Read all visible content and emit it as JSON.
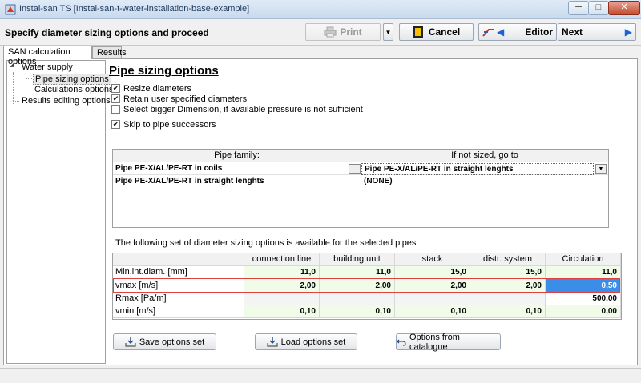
{
  "window": {
    "title": "Instal-san TS [Instal-san-t-water-installation-base-example]",
    "minimize": "─",
    "maximize": "□",
    "close": "✕"
  },
  "header": {
    "title": "Specify diameter sizing options and proceed",
    "print_label": "Print",
    "print_dropdown": "▼",
    "cancel_label": "Cancel",
    "editor_label": "Editor",
    "next_label": "Next",
    "left_arrow": "◀",
    "right_arrow": "▶"
  },
  "tabs": [
    {
      "label": "SAN calculation options"
    },
    {
      "label": "Results"
    }
  ],
  "tree": {
    "root": "Water supply",
    "expander": "◢",
    "children": [
      "Pipe sizing options",
      "Calculations options"
    ],
    "other": "Results editing options"
  },
  "section": {
    "title": "Pipe sizing options"
  },
  "checkboxes": [
    {
      "label": "Resize diameters",
      "checked": true
    },
    {
      "label": "Retain user specified diameters",
      "checked": true
    },
    {
      "label": "Select bigger Dimension, if available pressure is not sufficient",
      "checked": false
    },
    {
      "label": "Skip to pipe successors",
      "checked": true
    }
  ],
  "family_grid": {
    "headers": [
      "Pipe family:",
      "If not sized, go to"
    ],
    "rows": [
      [
        "Pipe PE-X/AL/PE-RT in coils",
        "Pipe PE-X/AL/PE-RT in straight lenghts"
      ],
      [
        "Pipe PE-X/AL/PE-RT in straight lenghts",
        "(NONE)"
      ]
    ],
    "dots": "...",
    "drop": "▼"
  },
  "info_text": "The following set of diameter sizing options is available for the selected pipes",
  "options_grid": {
    "headers": [
      "",
      "connection line",
      "building unit",
      "stack",
      "distr. system",
      "Circulation"
    ],
    "rows": [
      {
        "label": "Min.int.diam. [mm]",
        "values": [
          "11,0",
          "11,0",
          "15,0",
          "15,0",
          "11,0"
        ]
      },
      {
        "label": "vmax [m/s]",
        "values": [
          "2,00",
          "2,00",
          "2,00",
          "2,00",
          "0,50"
        ]
      },
      {
        "label": "Rmax [Pa/m]",
        "values": [
          "",
          "",
          "",
          "",
          "500,00"
        ]
      },
      {
        "label": "vmin [m/s]",
        "values": [
          "0,10",
          "0,10",
          "0,10",
          "0,10",
          "0,00"
        ]
      }
    ]
  },
  "actions": {
    "save": "Save options set",
    "load": "Load options set",
    "catalogue": "Options from catalogue"
  },
  "colors": {
    "accent_selection": "#3b8ee8",
    "highlight_border": "#e04040",
    "cell_green": "#f0fbe8"
  }
}
